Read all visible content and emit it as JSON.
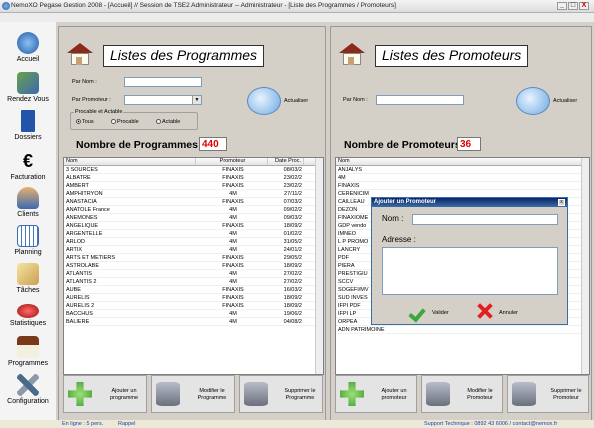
{
  "window": {
    "title": "NemoXO Pegase Gestion 2008 - [Accueil] // Session de TSE2 Administrateur -- Administrateur - [Liste des Programmes / Promoteurs]",
    "min": "_",
    "max": "□",
    "close": "X"
  },
  "sidebar": {
    "items": [
      {
        "label": "Accueil",
        "icon": "globe-icon",
        "color": "#2a6ebd"
      },
      {
        "label": "Rendez Vous",
        "icon": "people-icon",
        "color": "#5a8a3a"
      },
      {
        "label": "Dossiers",
        "icon": "folder-icon",
        "color": "#2255aa"
      },
      {
        "label": "Facturation",
        "icon": "euro-icon",
        "color": "#333333"
      },
      {
        "label": "Clients",
        "icon": "person-icon",
        "color": "#d28a30"
      },
      {
        "label": "Planning",
        "icon": "calendar-icon",
        "color": "#3a6ab0"
      },
      {
        "label": "Tâches",
        "icon": "tasks-icon",
        "color": "#caa050"
      },
      {
        "label": "Statistiques",
        "icon": "chart-icon",
        "color": "#c82020"
      },
      {
        "label": "Programmes",
        "icon": "house-icon",
        "color": "#7a3a1a"
      },
      {
        "label": "Configuration",
        "icon": "tools-icon",
        "color": "#4a6a8a"
      }
    ]
  },
  "left": {
    "title": "Listes des Programmes",
    "par_nom": "Par Nom :",
    "par_promoteur": "Par Promoteur :",
    "group_label": "Procable et Actable",
    "radios": [
      "Tous",
      "Procable",
      "Actable"
    ],
    "actualiser": "Actualiser",
    "count_label": "Nombre de Programmes :",
    "count": "440",
    "columns": [
      "Nom",
      "Promoteur",
      "Date Proc."
    ],
    "rows": [
      [
        "3 SOURCES",
        "FINAXIS",
        "08/03/2"
      ],
      [
        "ALBATRE",
        "FINAXIS",
        "23/02/2"
      ],
      [
        "AMBERT",
        "FINAXIS",
        "23/02/2"
      ],
      [
        "AMPHITRYON",
        "4M",
        "27/11/2"
      ],
      [
        "ANASTACIA",
        "FINAXIS",
        "07/03/2"
      ],
      [
        "ANATOLE France",
        "4M",
        "09/02/2"
      ],
      [
        "ANEMONES",
        "4M",
        "09/03/2"
      ],
      [
        "ANGELIQUE",
        "FINAXIS",
        "18/09/2"
      ],
      [
        "ARGENTELLE",
        "4M",
        "01/02/2"
      ],
      [
        "ARLOD",
        "4M",
        "31/05/2"
      ],
      [
        "ARTIX",
        "4M",
        "24/01/2"
      ],
      [
        "ARTS ET METIERS",
        "FINAXIS",
        "29/05/2"
      ],
      [
        "ASTROLABE",
        "FINAXIS",
        "18/09/2"
      ],
      [
        "ATLANTIS",
        "4M",
        "27/02/2"
      ],
      [
        "ATLANTIS 2",
        "4M",
        "27/02/2"
      ],
      [
        "AUBE",
        "FINAXIS",
        "16/03/2"
      ],
      [
        "AURELIS",
        "FINAXIS",
        "18/09/2"
      ],
      [
        "AURELIS 2",
        "FINAXIS",
        "18/09/2"
      ],
      [
        "BACCHUS",
        "4M",
        "19/06/2"
      ],
      [
        "BALIERE",
        "4M",
        "04/08/2"
      ]
    ],
    "buttons": [
      "Ajouter un programme",
      "Modifier le Programme",
      "Supprimer le Programme"
    ]
  },
  "right": {
    "title": "Listes des Promoteurs",
    "par_nom": "Par Nom :",
    "actualiser": "Actualiser",
    "count_label": "Nombre de Promoteurs :",
    "count": "36",
    "columns": [
      "Nom"
    ],
    "rows": [
      "ANJALYS",
      "4M",
      "FINAXIS",
      "CERENICIM",
      "CAILLEAU",
      "DEZON",
      "FINAXIOME",
      "GDP vendo",
      "IMNEO",
      "L P PROMO",
      "LANCRY",
      "PDF",
      "PIERA",
      "PRESTIGIU",
      "SCCV",
      "SOGEFI/MV",
      "SUD INVES",
      "IFPI PDF",
      "IFPI LP",
      "ORPEA",
      "ADN PATRIMOINE"
    ],
    "buttons": [
      "Ajouter un promoteur",
      "Modifier le Promoteur",
      "Supprimer le Promoteur"
    ]
  },
  "dialog": {
    "title": "Ajouter un Promoteur",
    "nom": "Nom :",
    "adresse": "Adresse :",
    "valider": "Valider",
    "annuler": "Annuler"
  },
  "status": {
    "online": "En ligne : 5 pers.",
    "rappel": "Rappel",
    "support": "Support Technique : 0892 43 6006 / contact@nemox.fr"
  }
}
